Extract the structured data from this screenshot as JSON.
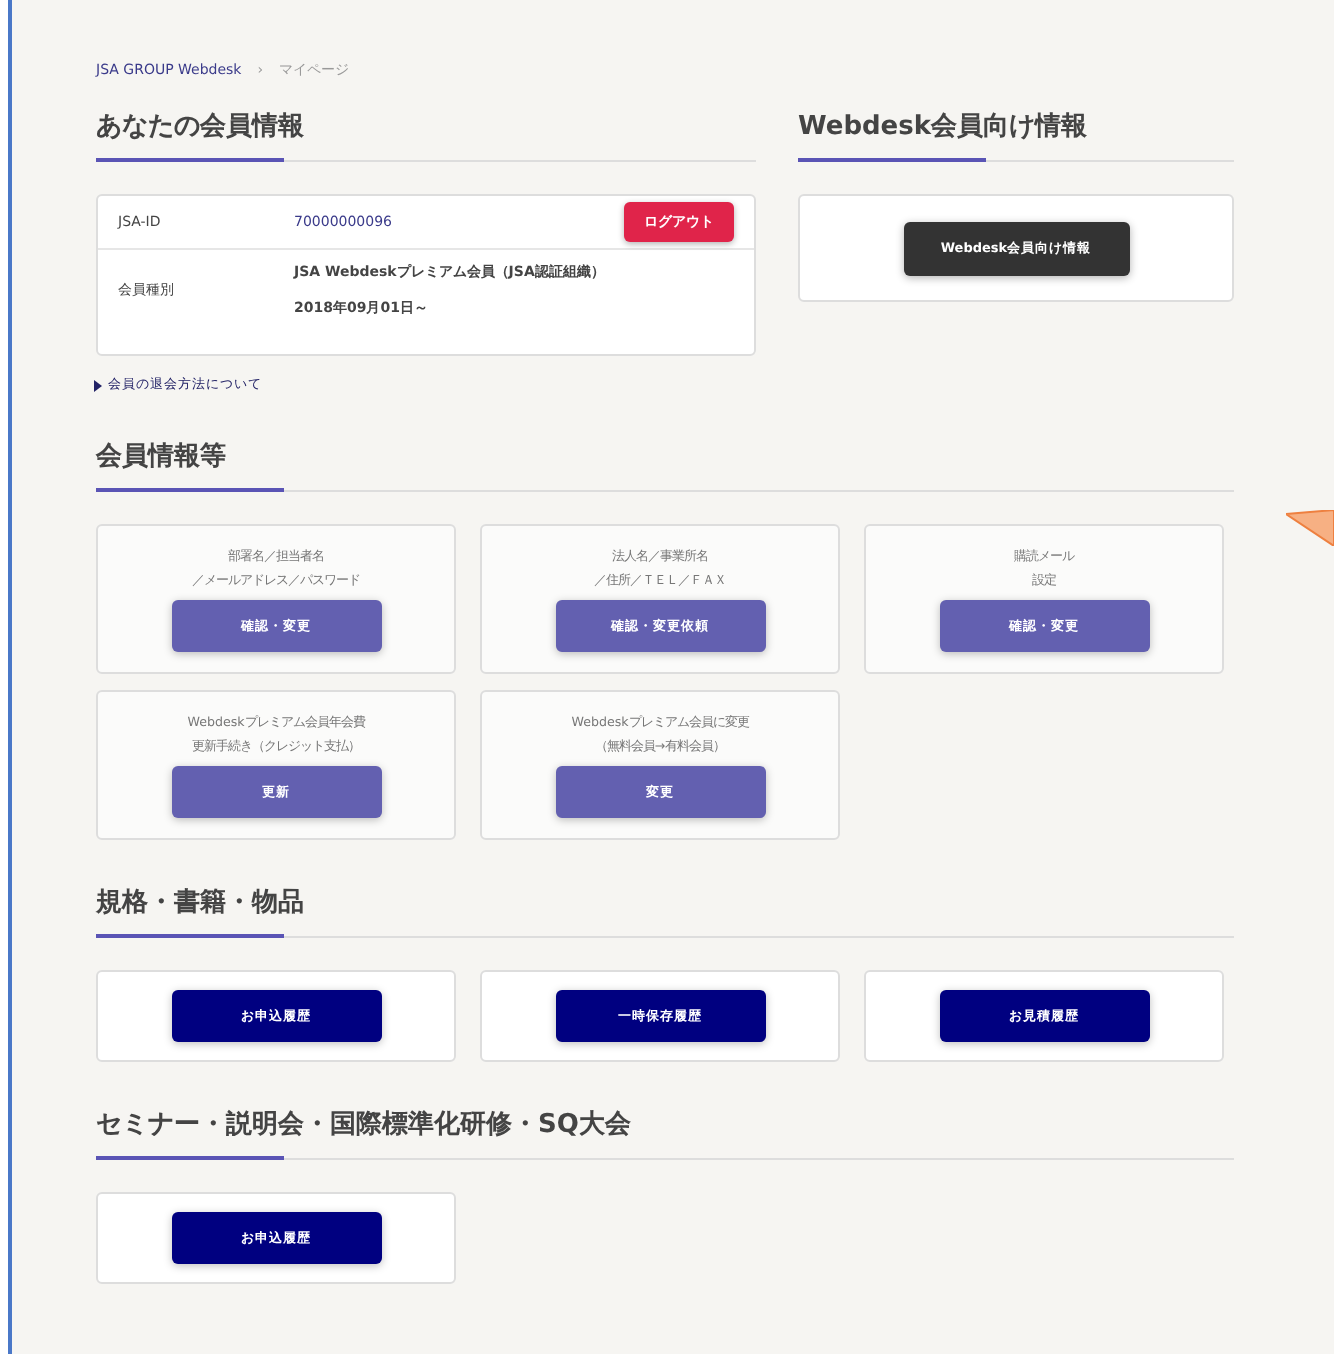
{
  "breadcrumb": [
    {
      "label": "JSA GROUP Webdesk",
      "kind": "link"
    },
    {
      "label": "›",
      "kind": "separator"
    },
    {
      "label": "マイページ",
      "kind": "current"
    }
  ],
  "member_info": {
    "title": "あなたの会員情報",
    "rows": [
      {
        "label": "JSA-ID",
        "values": [
          "70000000096"
        ],
        "kind": "id"
      },
      {
        "label": "会員種別",
        "values": [
          "JSA Webdeskプレミアム会員（JSA認証組織）",
          "2018年09月01日～"
        ],
        "kind": "plain"
      }
    ],
    "logout_button": "ログアウト",
    "withdraw_link": "会員の退会方法について"
  },
  "webdesk_info": {
    "title": "Webdesk会員向け情報",
    "button": "Webdesk会員向け情報"
  },
  "sections": [
    {
      "title": "会員情報等",
      "cards": [
        {
          "description": [
            "部署名／担当者名",
            "／メールアドレス／パスワード"
          ],
          "button": "確認・変更",
          "kind": "purple"
        },
        {
          "description": [
            "法人名／事業所名",
            "／住所／ＴＥＬ／ＦＡＸ"
          ],
          "button": "確認・変更依頼",
          "kind": "purple"
        },
        {
          "description": [
            "購読メール",
            "設定"
          ],
          "button": "確認・変更",
          "kind": "purple"
        },
        {
          "description": [
            "Webdeskプレミアム会員年会費",
            "更新手続き（クレジット支払）"
          ],
          "button": "更新",
          "kind": "purple"
        },
        {
          "description": [
            "Webdeskプレミアム会員に変更",
            "（無料会員→有料会員）"
          ],
          "button": "変更",
          "kind": "purple"
        }
      ]
    },
    {
      "title": "規格・書籍・物品",
      "cards": [
        {
          "button": "お申込履歴",
          "kind": "navy"
        },
        {
          "button": "一時保存履歴",
          "kind": "navy"
        },
        {
          "button": "お見積履歴",
          "kind": "navy"
        }
      ]
    },
    {
      "title": "セミナー・説明会・国際標準化研修・SQ大会",
      "cards": [
        {
          "button": "お申込履歴",
          "kind": "navy"
        }
      ]
    }
  ]
}
